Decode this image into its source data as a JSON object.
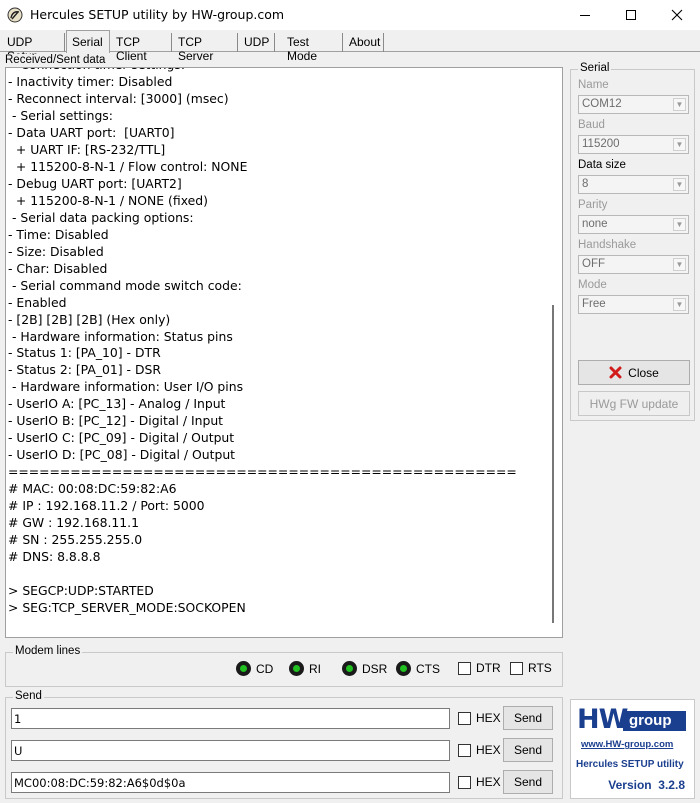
{
  "window": {
    "title": "Hercules SETUP utility by HW-group.com"
  },
  "tabs": [
    {
      "label": "UDP Setup"
    },
    {
      "label": "Serial"
    },
    {
      "label": "TCP Client"
    },
    {
      "label": "TCP Server"
    },
    {
      "label": "UDP"
    },
    {
      "label": "Test Mode"
    },
    {
      "label": "About"
    }
  ],
  "received": {
    "label": "Received/Sent data",
    "lines": [
      " - Connection timer settings:",
      "- Inactivity timer: Disabled",
      "- Reconnect interval: [3000] (msec)",
      " - Serial settings:",
      "- Data UART port:  [UART0]",
      "  + UART IF: [RS-232/TTL]",
      "  + 115200-8-N-1 / Flow control: NONE",
      "- Debug UART port: [UART2]",
      "  + 115200-8-N-1 / NONE (fixed)",
      " - Serial data packing options:",
      "- Time: Disabled",
      "- Size: Disabled",
      "- Char: Disabled",
      " - Serial command mode switch code:",
      "- Enabled",
      "- [2B] [2B] [2B] (Hex only)",
      " - Hardware information: Status pins",
      "- Status 1: [PA_10] - DTR",
      "- Status 2: [PA_01] - DSR",
      " - Hardware information: User I/O pins",
      "- UserIO A: [PC_13] - Analog / Input",
      "- UserIO B: [PC_12] - Digital / Input",
      "- UserIO C: [PC_09] - Digital / Output",
      "- UserIO D: [PC_08] - Digital / Output",
      "=================================================",
      "# MAC: 00:08:DC:59:82:A6",
      "# IP : 192.168.11.2 / Port: 5000",
      "# GW : 192.168.11.1",
      "# SN : 255.255.255.0",
      "# DNS: 8.8.8.8",
      "",
      "> SEGCP:UDP:STARTED",
      "> SEG:TCP_SERVER_MODE:SOCKOPEN"
    ]
  },
  "serial": {
    "group_label": "Serial",
    "fields": [
      {
        "label": "Name",
        "value": "COM12",
        "enabled": false
      },
      {
        "label": "Baud",
        "value": "115200",
        "enabled": false
      },
      {
        "label": "Data size",
        "value": "8",
        "enabled": true
      },
      {
        "label": "Parity",
        "value": "none",
        "enabled": false
      },
      {
        "label": "Handshake",
        "value": "OFF",
        "enabled": false
      },
      {
        "label": "Mode",
        "value": "Free",
        "enabled": false
      }
    ],
    "close_label": "Close",
    "fw_update_label": "HWg FW update"
  },
  "modem": {
    "label": "Modem lines",
    "indicators": [
      {
        "label": "CD",
        "state": "on"
      },
      {
        "label": "RI",
        "state": "on"
      },
      {
        "label": "DSR",
        "state": "on"
      },
      {
        "label": "CTS",
        "state": "on"
      }
    ],
    "controls": [
      {
        "label": "DTR",
        "checked": false
      },
      {
        "label": "RTS",
        "checked": false
      }
    ]
  },
  "send": {
    "label": "Send",
    "rows": [
      {
        "value": "1",
        "hex_label": "HEX",
        "hex_checked": false,
        "button": "Send"
      },
      {
        "value": "U",
        "hex_label": "HEX",
        "hex_checked": false,
        "button": "Send"
      },
      {
        "value": "MC00:08:DC:59:82:A6$0d$0a",
        "hex_label": "HEX",
        "hex_checked": false,
        "button": "Send"
      }
    ]
  },
  "logo": {
    "brand_left": "HW",
    "brand_right": "group",
    "url": "www.HW-group.com",
    "product": "Hercules SETUP utility",
    "version": "Version  3.2.8"
  },
  "colors": {
    "logo_blue": "#1b3f8f",
    "led_green": "#20c020",
    "close_red": "#d21b1b"
  }
}
